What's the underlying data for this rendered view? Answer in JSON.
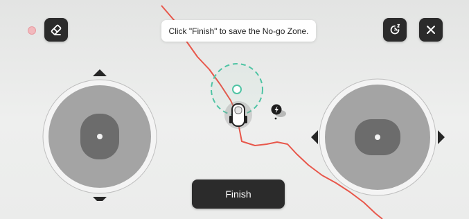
{
  "screen": {
    "tooltip_text": "Click \"Finish\" to save the No-go Zone.",
    "finish_label": "Finish"
  },
  "icons": {
    "recording_indicator": "recording-dot-icon",
    "eraser": "eraser-icon",
    "rotate": "rotate-icon",
    "close": "close-icon",
    "robot": "robot-mower-icon",
    "charging_station": "charging-station-icon",
    "zone_handle": "zone-center-handle-icon"
  },
  "colors": {
    "path_line": "#e8574b",
    "zone_outline": "#4fc4a4",
    "dark_button": "#2b2b2b",
    "recording_dot": "#f2b9bd"
  }
}
